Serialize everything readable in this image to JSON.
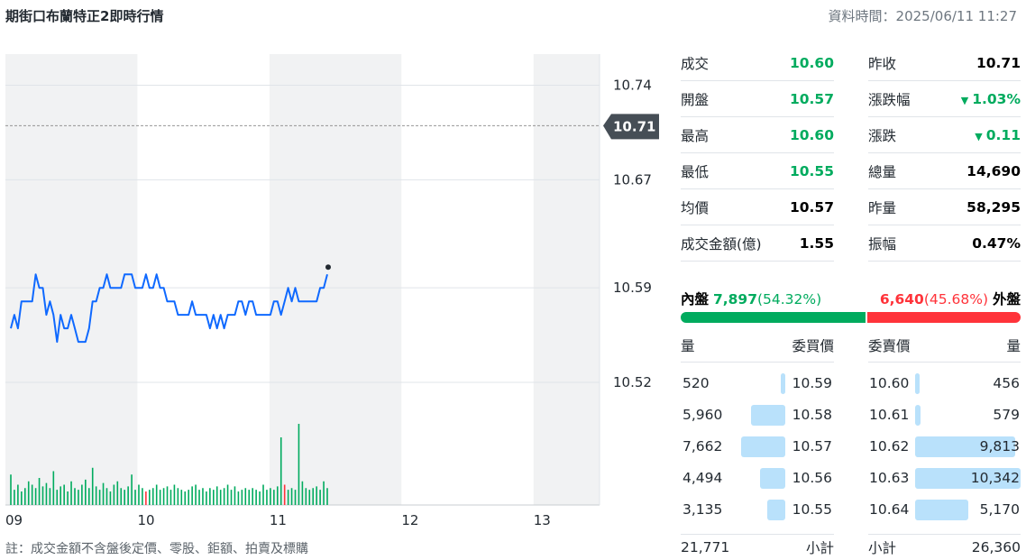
{
  "header": {
    "title": "期街口布蘭特正2即時行情",
    "time_label": "資料時間：2025/06/11 11:27"
  },
  "chart_data": {
    "type": "line",
    "y_ticks": [
      "10.74",
      "10.67",
      "10.59",
      "10.52"
    ],
    "ylim": [
      10.496,
      10.763
    ],
    "x_ticks": [
      "09",
      "10",
      "11",
      "12",
      "13"
    ],
    "prev_close": 10.71,
    "prev_close_label": "10.71",
    "line_color": "#0f69ff",
    "series": [
      {
        "values": [
          10.56,
          10.57,
          10.56,
          10.58,
          10.58,
          10.58,
          10.58,
          10.6,
          10.59,
          10.59,
          10.57,
          10.58,
          10.57,
          10.55,
          10.57,
          10.56,
          10.56,
          10.57,
          10.56,
          10.55,
          10.55,
          10.55,
          10.56,
          10.58,
          10.58,
          10.59,
          10.59,
          10.6,
          10.59,
          10.59,
          10.59,
          10.59,
          10.6,
          10.6,
          10.6,
          10.59,
          10.59,
          10.59,
          10.6,
          10.59,
          10.59,
          10.6,
          10.59,
          10.59,
          10.58,
          10.58,
          10.58,
          10.57,
          10.57,
          10.57,
          10.57,
          10.58,
          10.57,
          10.57,
          10.57,
          10.57,
          10.56,
          10.57,
          10.56,
          10.57,
          10.56,
          10.57,
          10.57,
          10.57,
          10.58,
          10.58,
          10.57,
          10.58,
          10.58,
          10.57,
          10.57,
          10.57,
          10.57,
          10.57,
          10.58,
          10.58,
          10.57,
          10.58,
          10.59,
          10.58,
          10.59,
          10.58,
          10.58,
          10.58,
          10.58,
          10.58,
          10.58,
          10.59,
          10.59,
          10.6
        ]
      }
    ],
    "volume": [
      18,
      9,
      12,
      8,
      10,
      14,
      12,
      10,
      16,
      11,
      13,
      10,
      20,
      9,
      11,
      12,
      8,
      14,
      10,
      9,
      12,
      15,
      10,
      22,
      11,
      9,
      13,
      10,
      8,
      12,
      14,
      10,
      9,
      11,
      18,
      9,
      12,
      10,
      8,
      9,
      10,
      12,
      9,
      10,
      11,
      9,
      12,
      10,
      9,
      8,
      9,
      11,
      12,
      9,
      10,
      8,
      10,
      9,
      11,
      9,
      10,
      12,
      9,
      11,
      8,
      9,
      10,
      9,
      10,
      9,
      8,
      12,
      9,
      10,
      9,
      11,
      40,
      12,
      9,
      10,
      9,
      48,
      14,
      10,
      9,
      10,
      11,
      9,
      14,
      10
    ],
    "volume_red_indices": [
      38,
      77
    ],
    "volume_up_color": "#00ab5e",
    "volume_down_color": "#ff333a"
  },
  "quote": {
    "left": [
      {
        "label": "成交",
        "value": "10.60",
        "color": "green"
      },
      {
        "label": "開盤",
        "value": "10.57",
        "color": "green"
      },
      {
        "label": "最高",
        "value": "10.60",
        "color": "green"
      },
      {
        "label": "最低",
        "value": "10.55",
        "color": "green"
      },
      {
        "label": "均價",
        "value": "10.57",
        "color": "black"
      },
      {
        "label": "成交金額(億)",
        "value": "1.55",
        "color": "black"
      }
    ],
    "right": [
      {
        "label": "昨收",
        "value": "10.71",
        "color": "black"
      },
      {
        "label": "漲跌幅",
        "value": "1.03%",
        "color": "green",
        "arrow": "down"
      },
      {
        "label": "漲跌",
        "value": "0.11",
        "color": "green",
        "arrow": "down"
      },
      {
        "label": "總量",
        "value": "14,690",
        "color": "black"
      },
      {
        "label": "昨量",
        "value": "58,295",
        "color": "black"
      },
      {
        "label": "振幅",
        "value": "0.47%",
        "color": "black"
      }
    ]
  },
  "inner_outer": {
    "inner_label": "內盤",
    "inner_value": "7,897",
    "inner_pct": "(54.32%)",
    "outer_value": "6,640",
    "outer_pct": "(45.68%)",
    "outer_label": "外盤",
    "inner_fraction": 0.5432
  },
  "order_book": {
    "bid_headers": {
      "qty": "量",
      "price": "委買價"
    },
    "ask_headers": {
      "price": "委賣價",
      "qty": "量"
    },
    "bids": [
      {
        "qty": "520",
        "price": "10.59",
        "fraction": 0.05
      },
      {
        "qty": "5,960",
        "price": "10.58",
        "fraction": 0.58
      },
      {
        "qty": "7,662",
        "price": "10.57",
        "fraction": 0.74
      },
      {
        "qty": "4,494",
        "price": "10.56",
        "fraction": 0.43
      },
      {
        "qty": "3,135",
        "price": "10.55",
        "fraction": 0.31
      }
    ],
    "asks": [
      {
        "price": "10.60",
        "qty": "456",
        "fraction": 0.04
      },
      {
        "price": "10.61",
        "qty": "579",
        "fraction": 0.05
      },
      {
        "price": "10.62",
        "qty": "9,813",
        "fraction": 0.95
      },
      {
        "price": "10.63",
        "qty": "10,342",
        "fraction": 1.0
      },
      {
        "price": "10.64",
        "qty": "5,170",
        "fraction": 0.5
      }
    ],
    "bid_total": "21,771",
    "bid_total_label": "小計",
    "ask_total_label": "小計",
    "ask_total": "26,360"
  },
  "footnote": "註：成交金額不含盤後定價、零股、鉅額、拍賣及標購"
}
